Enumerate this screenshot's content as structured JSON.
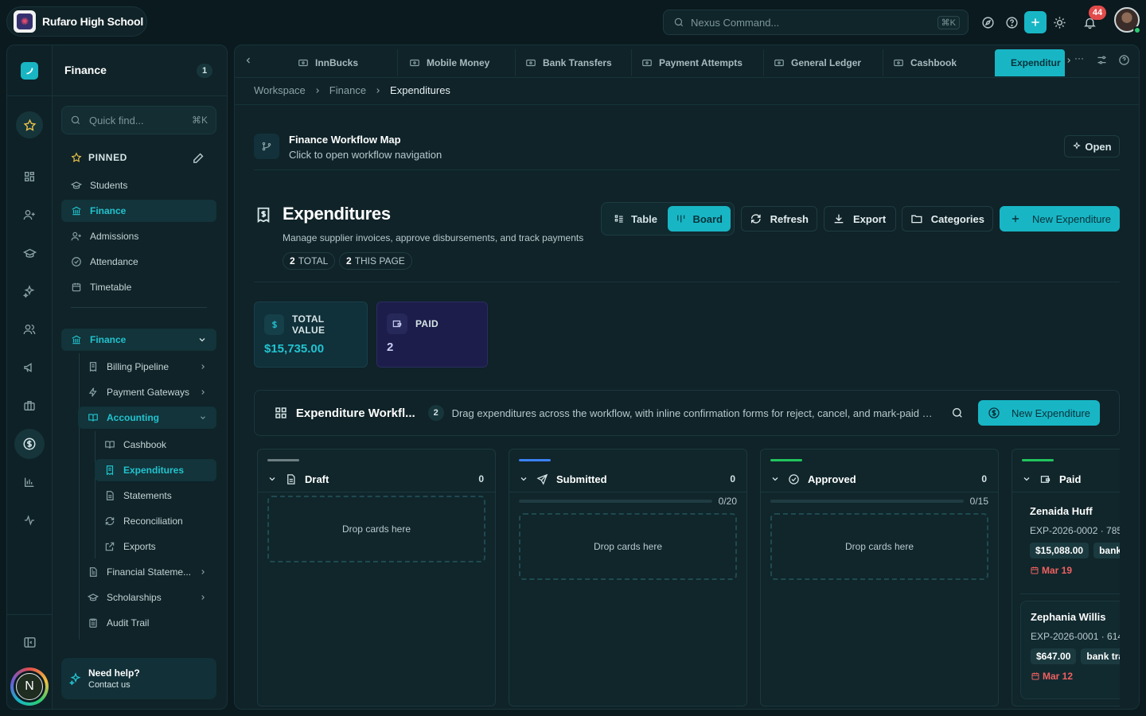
{
  "app": {
    "school_name": "Rufaro High School",
    "command_placeholder": "Nexus Command...",
    "command_shortcut": "⌘K",
    "notification_count": "44",
    "user_initial": "N",
    "accent_color": "#18b6c5"
  },
  "sidebar": {
    "section_title": "Finance",
    "section_count": "1",
    "search_placeholder": "Quick find...",
    "search_shortcut": "⌘K",
    "pinned_label": "PINNED",
    "pinned_items": [
      {
        "label": "Students",
        "icon": "graduation-cap-icon"
      },
      {
        "label": "Finance",
        "icon": "bank-icon"
      },
      {
        "label": "Admissions",
        "icon": "user-plus-icon"
      },
      {
        "label": "Attendance",
        "icon": "check-circle-icon"
      },
      {
        "label": "Timetable",
        "icon": "calendar-icon"
      }
    ],
    "group_label": "Finance",
    "tree": [
      {
        "label": "Billing Pipeline",
        "icon": "receipt-icon"
      },
      {
        "label": "Payment Gateways",
        "icon": "lightning-icon"
      },
      {
        "label": "Accounting",
        "icon": "book-open-icon"
      },
      {
        "label": "Cashbook",
        "icon": "book-icon"
      },
      {
        "label": "Expenditures",
        "icon": "receipt-icon"
      },
      {
        "label": "Statements",
        "icon": "file-icon"
      },
      {
        "label": "Reconciliation",
        "icon": "refresh-icon"
      },
      {
        "label": "Exports",
        "icon": "export-icon"
      },
      {
        "label": "Financial Stateme...",
        "icon": "file-text-icon"
      },
      {
        "label": "Scholarships",
        "icon": "graduation-cap-icon"
      },
      {
        "label": "Audit Trail",
        "icon": "clipboard-icon"
      }
    ],
    "help_title": "Need help?",
    "help_sub": "Contact us"
  },
  "tabs": [
    "InnBucks",
    "Mobile Money",
    "Bank Transfers",
    "Payment Attempts",
    "General Ledger",
    "Cashbook",
    "Expenditur"
  ],
  "breadcrumb": [
    "Workspace",
    "Finance",
    "Expenditures"
  ],
  "workflow_map": {
    "title": "Finance Workflow Map",
    "subtitle": "Click to open workflow navigation",
    "open_label": "Open"
  },
  "page": {
    "title": "Expenditures",
    "subtitle": "Manage supplier invoices, approve disbursements, and track payments",
    "total_count": "2",
    "total_label": "TOTAL",
    "page_count": "2",
    "page_label": "THIS PAGE",
    "view_table": "Table",
    "view_board": "Board",
    "refresh": "Refresh",
    "export": "Export",
    "categories": "Categories",
    "new_expenditure": "New Expenditure"
  },
  "stats": [
    {
      "label": "TOTAL VALUE",
      "value": "$15,735.00"
    },
    {
      "label": "PAID",
      "value": "2"
    }
  ],
  "board": {
    "title": "Expenditure Workfl...",
    "count": "2",
    "description": "Drag expenditures across the workflow, with inline confirmation forms for reject, cancel, and mark-paid s...",
    "new_label": "New Expenditure",
    "drop_text": "Drop cards here",
    "columns": [
      {
        "name": "Draft",
        "count": "0",
        "progress": "",
        "color": "#6e7f82"
      },
      {
        "name": "Submitted",
        "count": "0",
        "progress": "0/20",
        "color": "#3b82f6"
      },
      {
        "name": "Approved",
        "count": "0",
        "progress": "0/15",
        "color": "#22c55e"
      },
      {
        "name": "Paid",
        "count": "",
        "progress": "",
        "color": "#22c55e"
      }
    ],
    "cards": [
      {
        "name": "Zenaida Huff",
        "ref": "EXP-2026-0002 · 785",
        "amount": "$15,088.00",
        "method": "bank",
        "due": "Mar 19"
      },
      {
        "name": "Zephania Willis",
        "ref": "EXP-2026-0001 · 614",
        "amount": "$647.00",
        "method": "bank tra",
        "due": "Mar 12"
      }
    ]
  }
}
